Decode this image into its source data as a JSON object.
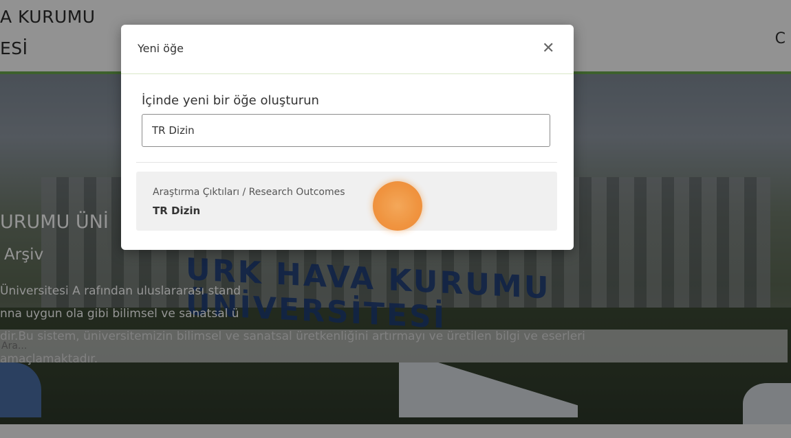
{
  "header": {
    "brand_line1": "A KURUMU",
    "brand_line2": "ESİ",
    "right_text": "C"
  },
  "hero": {
    "title": "URUMU ÜNİ",
    "subtitle": "Arşiv",
    "description": "Üniversitesi A                                                                        rafından uluslararası stand\nnna uygun ola                                                                          gibi bilimsel ve sanatsal ü\ndir.Bu sistem, üniversitemizin bilimsel ve sanatsal üretkenliğini artırmayı ve üretilen bilgi ve eserleri\namaçlamaktadır.",
    "sign_text": "URK HAVA KURUMU ÜNİVERSİTESİ"
  },
  "search": {
    "placeholder": "Ara..."
  },
  "modal": {
    "title": "Yeni öğe",
    "close_icon": "close-icon",
    "label": "İçinde yeni bir öğe oluşturun",
    "input_value": "TR Dizin",
    "result": {
      "path": "Araştırma Çıktıları / Research Outcomes",
      "name": "TR Dizin"
    }
  },
  "colors": {
    "header_accent": "#6aa84f",
    "click_indicator": "#f08a2c"
  }
}
